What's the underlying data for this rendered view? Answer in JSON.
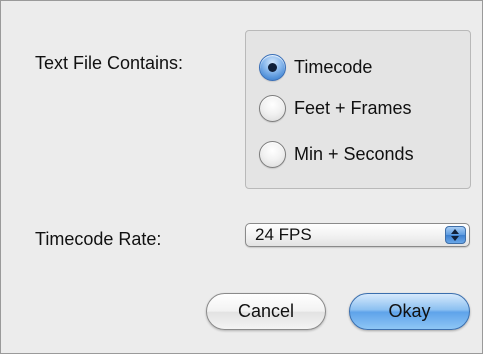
{
  "dialog": {
    "contains_label": "Text File Contains:",
    "contains_options": [
      {
        "label": "Timecode",
        "selected": true
      },
      {
        "label": "Feet + Frames",
        "selected": false
      },
      {
        "label": "Min + Seconds",
        "selected": false
      }
    ],
    "rate_label": "Timecode Rate:",
    "rate_value": "24 FPS",
    "cancel_label": "Cancel",
    "okay_label": "Okay"
  },
  "colors": {
    "dialog_bg": "#ececec",
    "accent_blue": "#5fa3ea"
  },
  "icons": {
    "select_arrows": "up-down-arrows-icon"
  }
}
